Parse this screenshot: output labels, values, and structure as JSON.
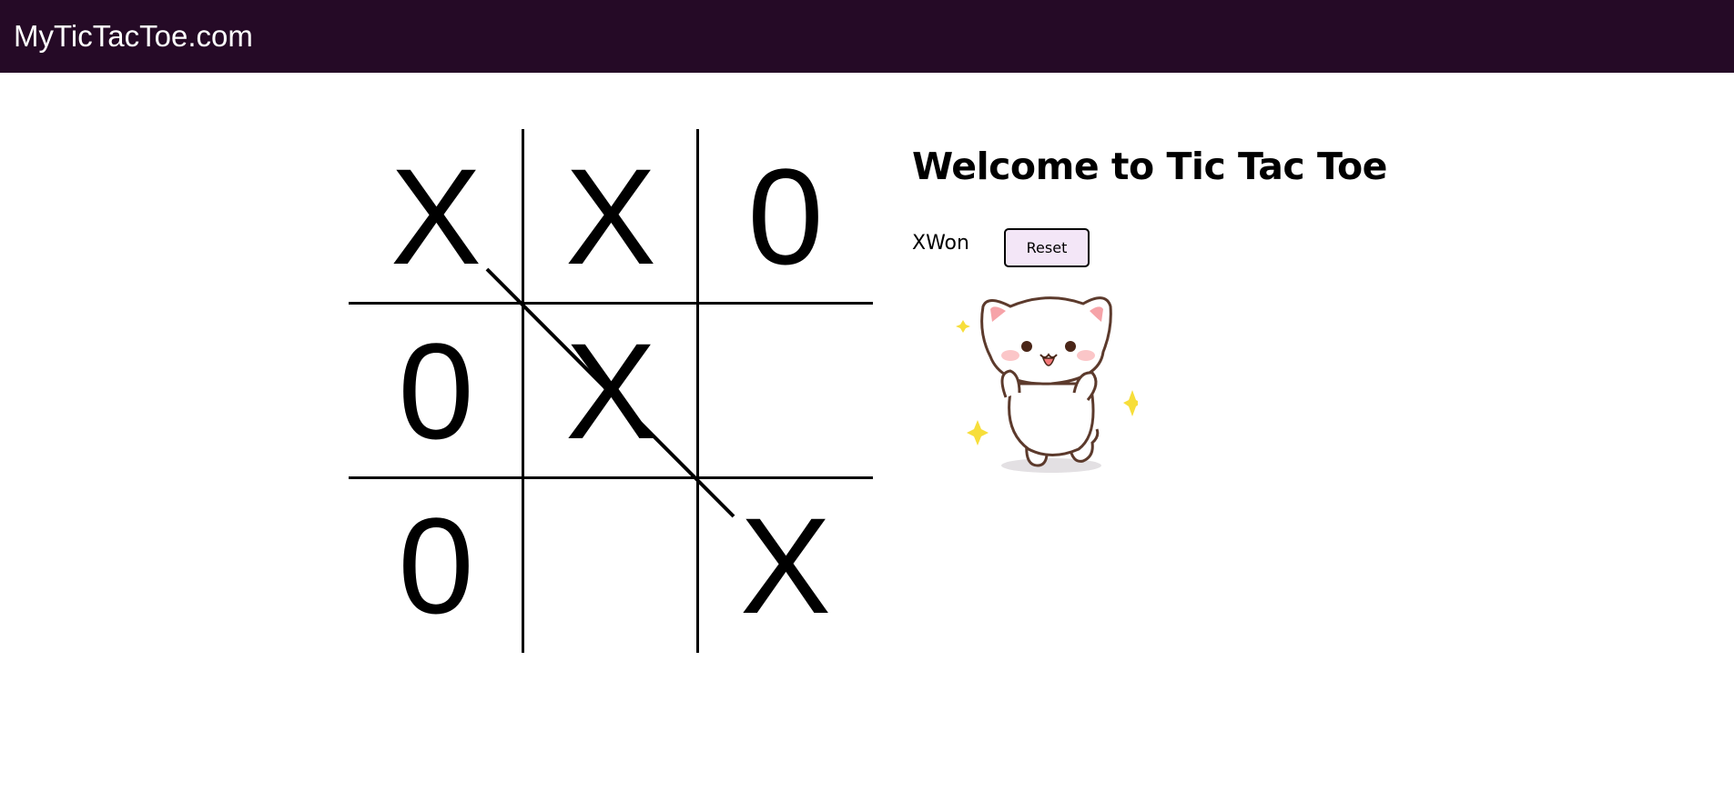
{
  "navbar": {
    "brand": "MyTicTacToe.com"
  },
  "game": {
    "title": "Welcome to Tic Tac Toe",
    "status": "XWon",
    "reset_label": "Reset",
    "board": [
      "X",
      "X",
      "0",
      "0",
      "X",
      "",
      "0",
      "",
      "X"
    ],
    "winning_line": [
      0,
      4,
      8
    ]
  },
  "image": {
    "icon": "happy-cat-sticker"
  }
}
